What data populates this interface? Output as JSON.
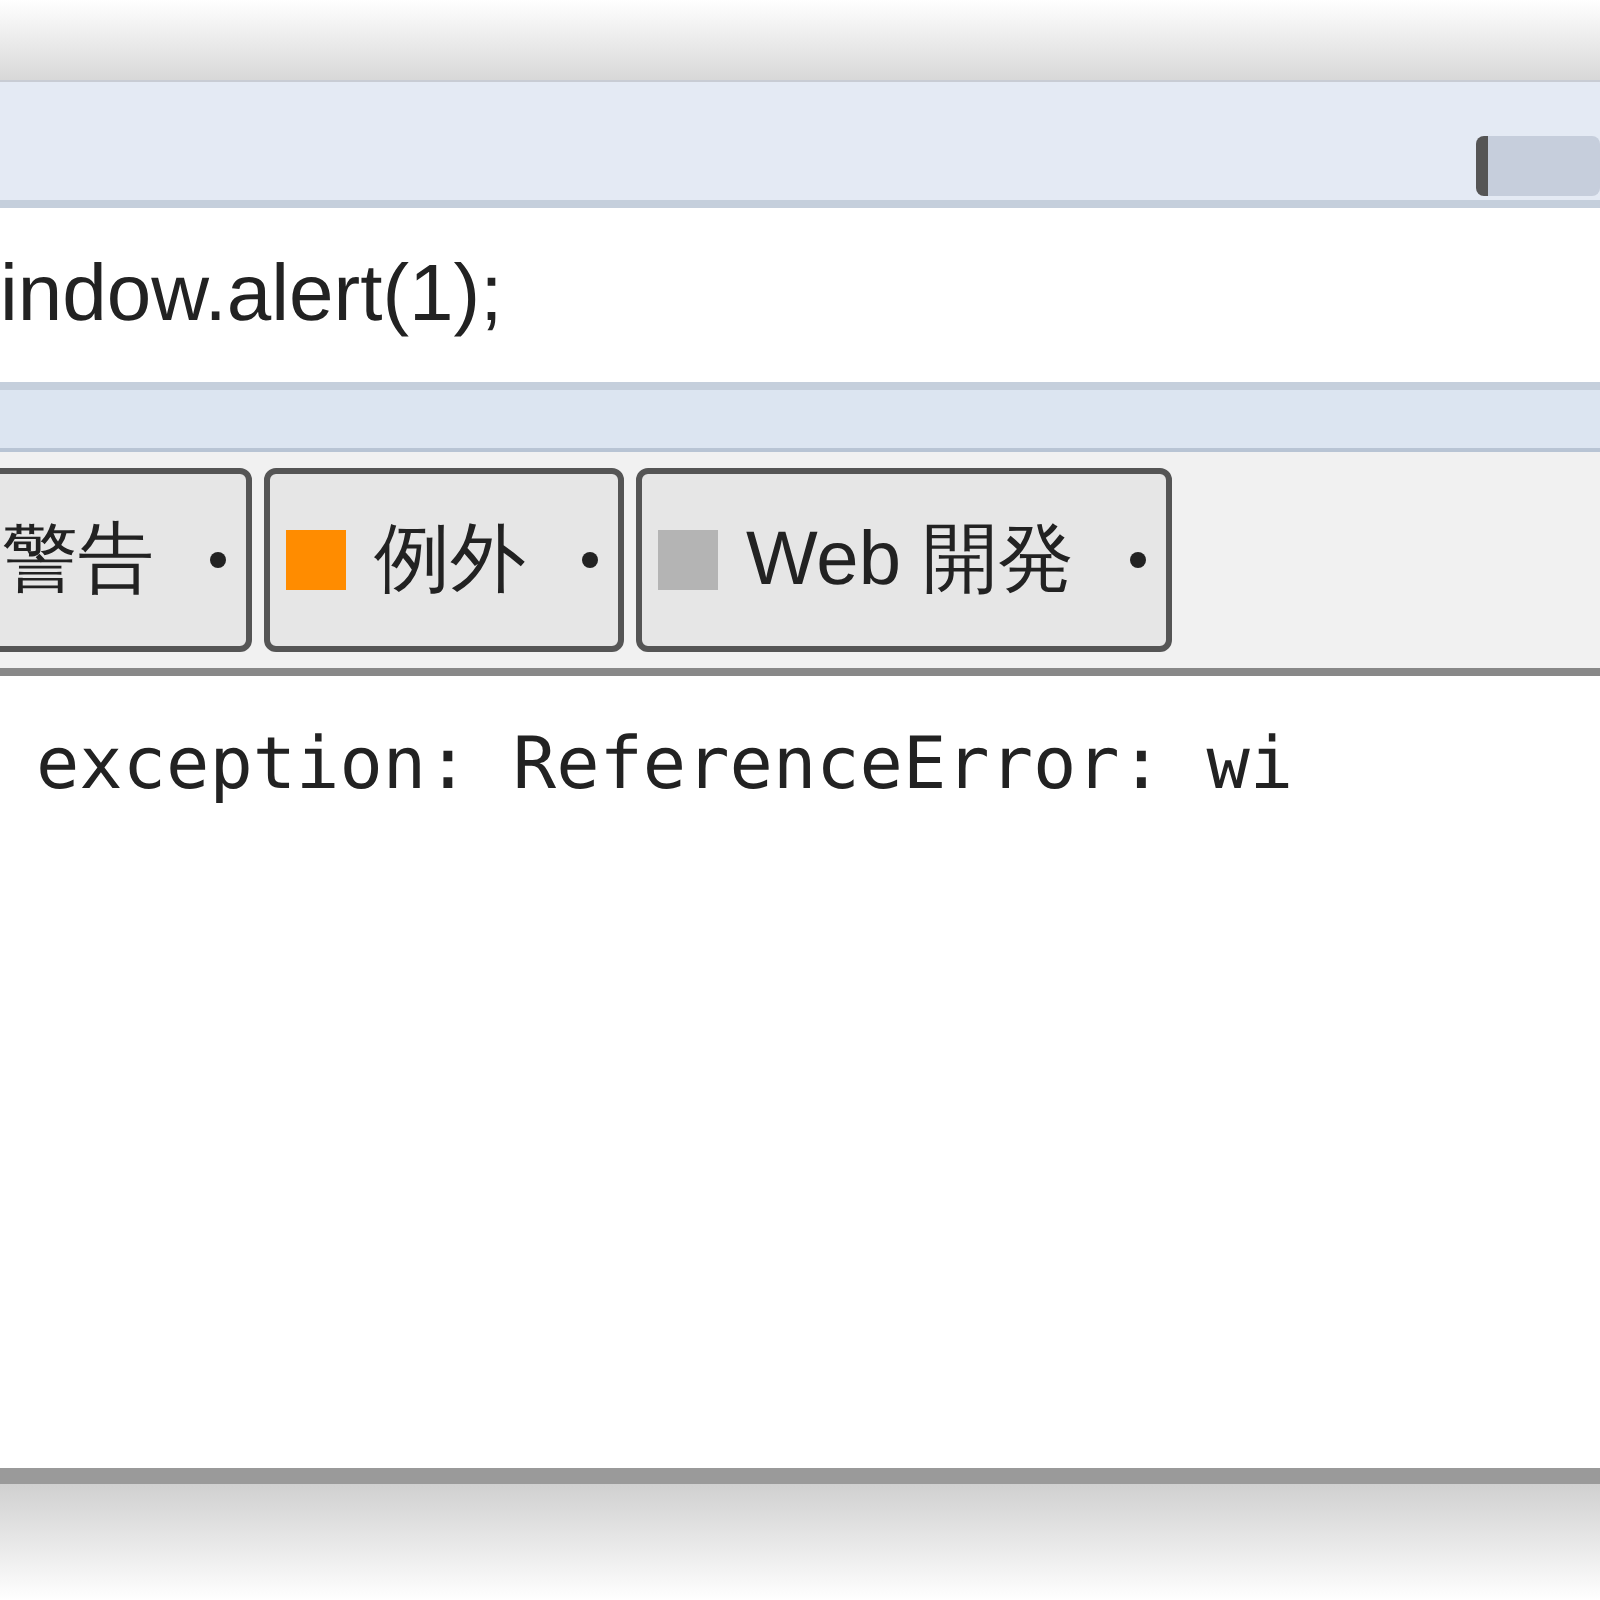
{
  "command_input": {
    "value": "indow.alert(1);"
  },
  "filters": [
    {
      "label": "警告"
    },
    {
      "label": "例外",
      "color": "#ff8c00"
    },
    {
      "label": "Web 開発",
      "color": "#b4b4b4"
    }
  ],
  "log_lines": [
    "exception: ReferenceError: wi"
  ]
}
